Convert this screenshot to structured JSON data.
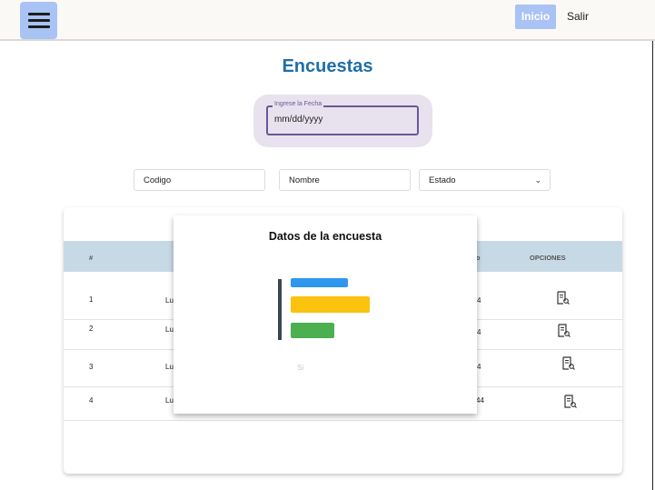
{
  "header": {
    "menu_icon": "hamburger-menu-icon",
    "nav_inicio": "Inicio",
    "nav_salir": "Salir",
    "accent": "#a9c3f4"
  },
  "page": {
    "title": "Encuestas",
    "title_color": "#1f6fa8"
  },
  "date_filter": {
    "label": "Ingrese la Fecha",
    "value": "mm/dd/yyyy"
  },
  "filters": {
    "codigo_placeholder": "Codigo",
    "nombre_placeholder": "Nombre",
    "estado_selected": "Estado"
  },
  "table": {
    "headers": [
      "#",
      "OPCIONES"
    ],
    "partial_header": "o",
    "rows": [
      {
        "num": "1",
        "col2": "Lu",
        "col3": "4"
      },
      {
        "num": "2",
        "col2": "Lu",
        "col3": "4"
      },
      {
        "num": "3",
        "col2": "Lu",
        "col3": "4"
      },
      {
        "num": "4",
        "col2": "Lu",
        "col3": "44"
      }
    ],
    "option_icon": "document-search-icon"
  },
  "modal": {
    "title": "Datos de la  encuesta",
    "label": "Si"
  },
  "chart_data": {
    "type": "bar",
    "orientation": "horizontal",
    "title": "Datos de la  encuesta",
    "categories": [
      "",
      "",
      ""
    ],
    "values": [
      63,
      87,
      48
    ],
    "colors": [
      "#2f97ee",
      "#fbc20e",
      "#4caf50"
    ]
  }
}
